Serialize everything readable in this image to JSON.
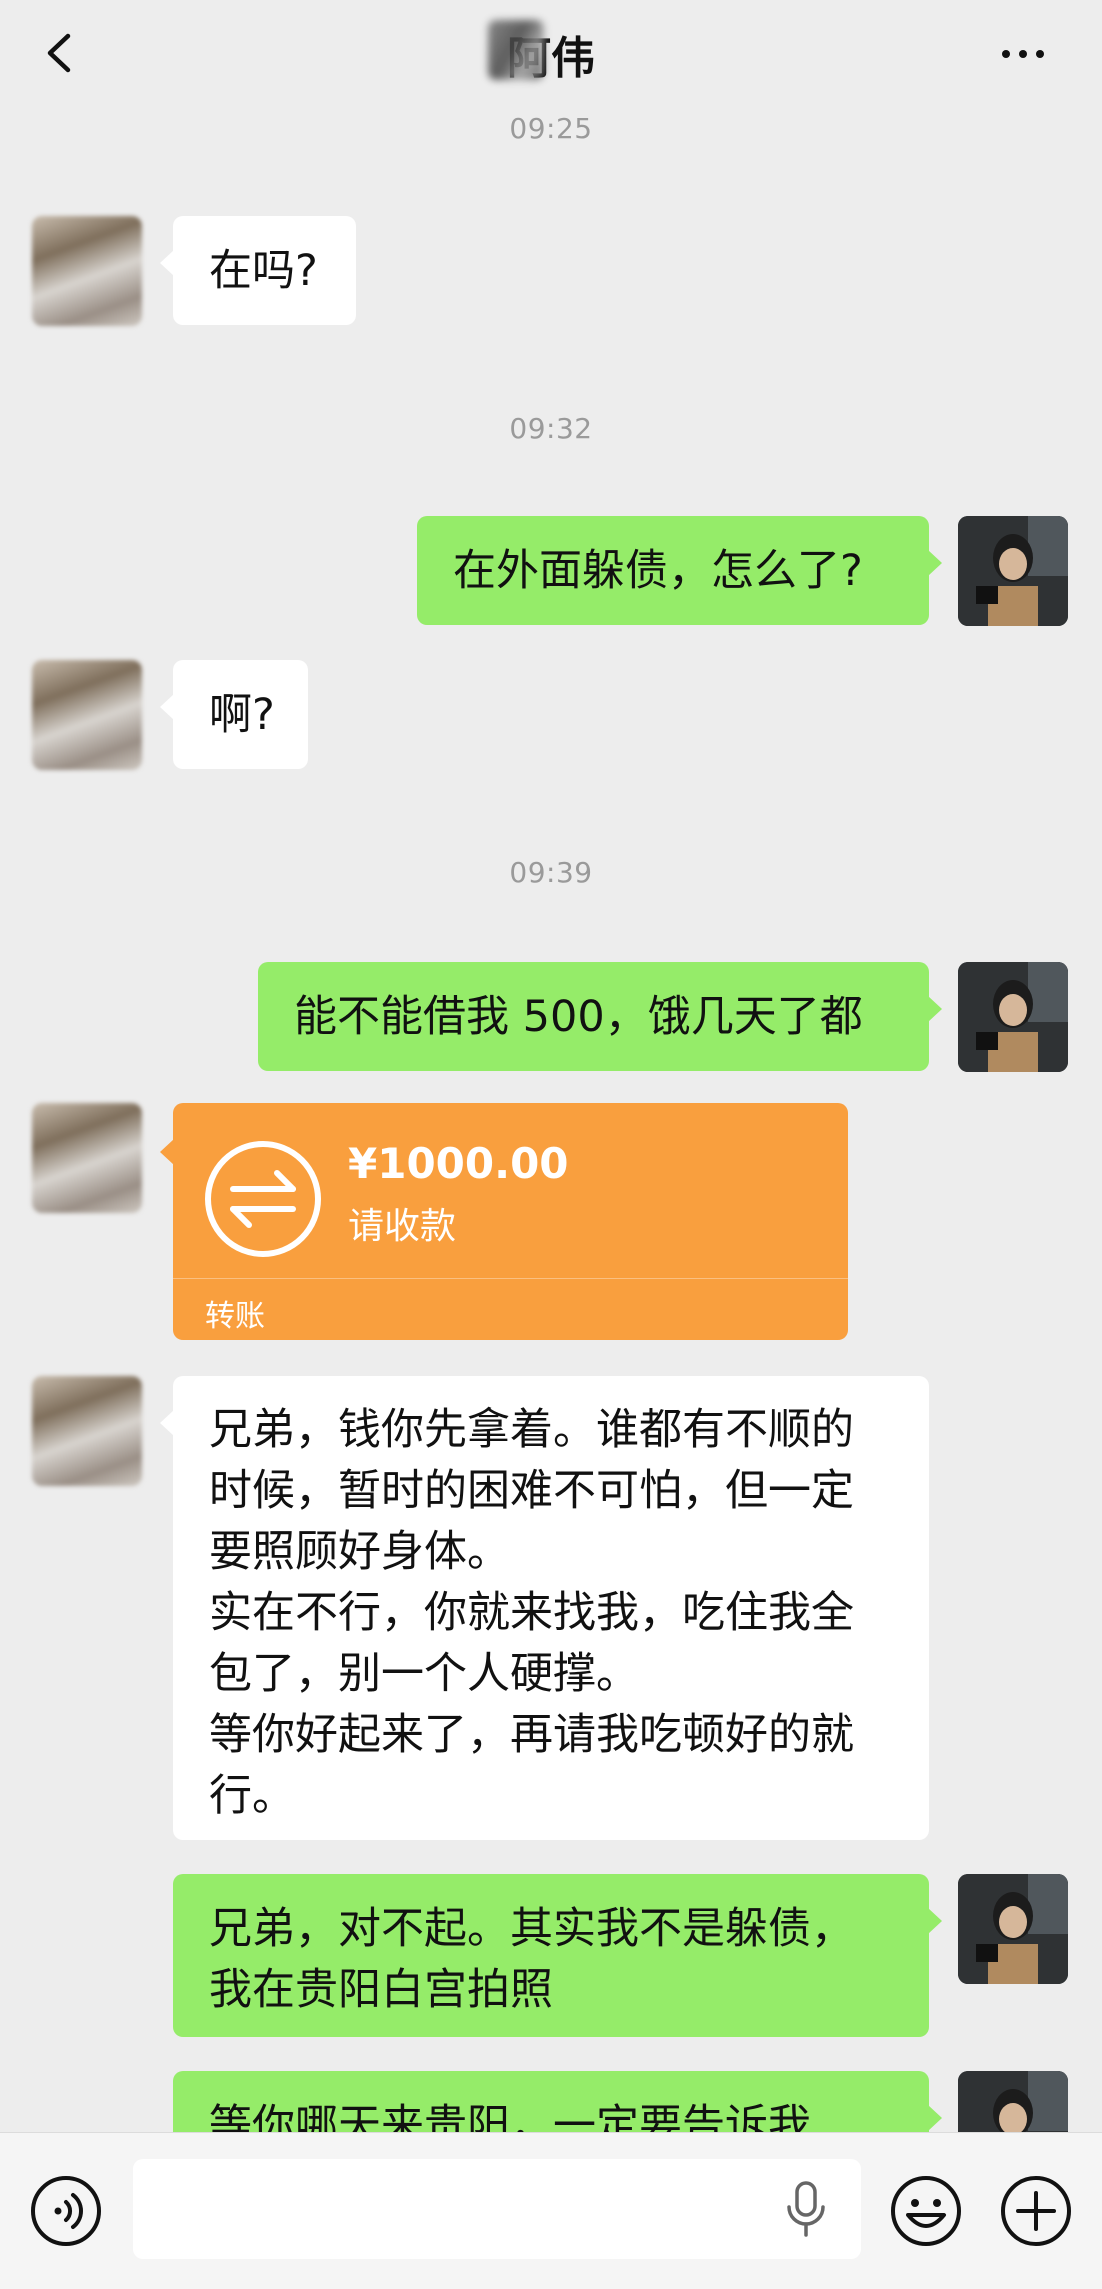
{
  "header": {
    "title": "阿伟",
    "back_icon": "chevron-left-icon",
    "more_icon": "more-dots-icon"
  },
  "messages": {
    "t1": "09:25",
    "m1": "在吗?",
    "t2": "09:32",
    "m2": "在外面躲债，怎么了?",
    "m3": "啊?",
    "t3": "09:39",
    "m4": "能不能借我 500，饿几天了都",
    "transfer": {
      "amount": "¥1000.00",
      "status": "请收款",
      "label": "转账",
      "color": "#f99f3e"
    },
    "m5_lines": [
      "兄弟，钱你先拿着。谁都有不顺的",
      "时候，暂时的困难不可怕，但一定",
      "要照顾好身体。",
      "实在不行，你就来找我，吃住我全",
      "包了，别一个人硬撑。",
      "等你好起来了，再请我吃顿好的就",
      "行。"
    ],
    "m6_lines": [
      "兄弟，对不起。其实我不是躲债，",
      "我在贵阳白宫拍照"
    ],
    "m7": "等你哪天来贵阳，一定要告诉我"
  },
  "composer": {
    "voice_icon": "voice-mode-icon",
    "mic_icon": "microphone-icon",
    "emoji_icon": "emoji-icon",
    "plus_icon": "plus-icon"
  },
  "colors": {
    "background": "#ededed",
    "bubble_self": "#95ec69",
    "bubble_other": "#ffffff"
  }
}
